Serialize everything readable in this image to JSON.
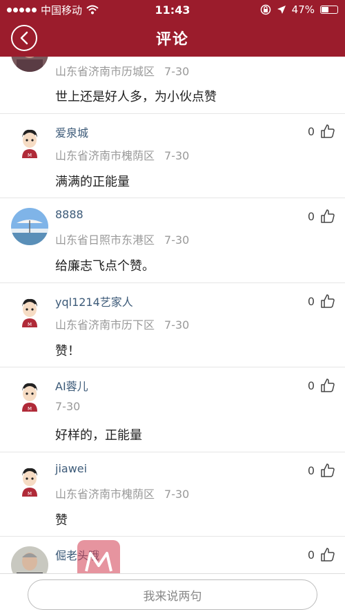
{
  "status_bar": {
    "carrier": "中国移动",
    "time": "11:43",
    "battery": "47%"
  },
  "nav": {
    "title": "评论"
  },
  "comments": [
    {
      "name": "",
      "location": "山东省济南市历城区",
      "date": "7-30",
      "text": "世上还是好人多，为小伙点赞",
      "likes": "",
      "avatar": "photo-avatar"
    },
    {
      "name": "爱泉城",
      "location": "山东省济南市槐荫区",
      "date": "7-30",
      "text": "满满的正能量",
      "likes": "0",
      "avatar": "cartoon-avatar"
    },
    {
      "name": "8888",
      "location": "山东省日照市东港区",
      "date": "7-30",
      "text": "给廉志飞点个赞。",
      "likes": "0",
      "avatar": "beach-avatar"
    },
    {
      "name": "yql1214艺家人",
      "location": "山东省济南市历下区",
      "date": "7-30",
      "text": "赞！",
      "likes": "0",
      "avatar": "cartoon-avatar"
    },
    {
      "name": "AI蓉儿",
      "location": "",
      "date": "7-30",
      "text": "好样的，正能量",
      "likes": "0",
      "avatar": "cartoon-avatar"
    },
    {
      "name": "jiawei",
      "location": "山东省济南市槐荫区",
      "date": "7-30",
      "text": "赞",
      "likes": "0",
      "avatar": "cartoon-avatar"
    },
    {
      "name": "倔老头哦",
      "location": "",
      "date": "",
      "text": "",
      "likes": "0",
      "avatar": "photo-avatar"
    }
  ],
  "bottom": {
    "placeholder": "我来说两句"
  }
}
